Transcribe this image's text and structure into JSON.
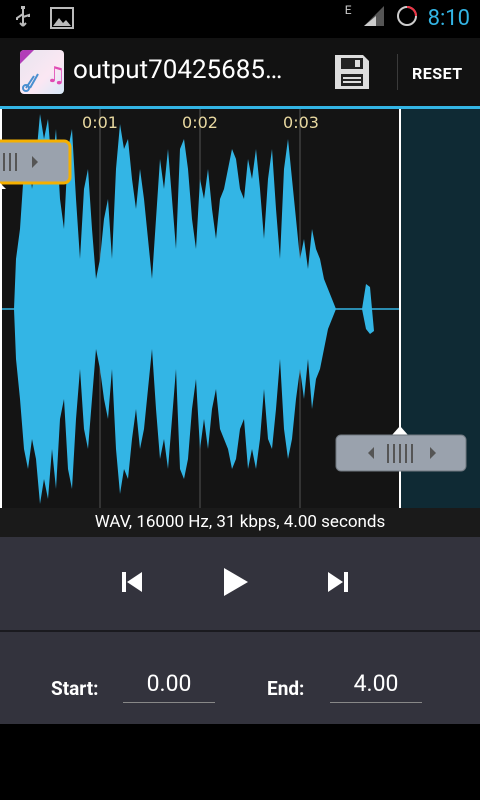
{
  "status_bar": {
    "time": "8:10",
    "network": "E"
  },
  "action_bar": {
    "title": "output70425685…",
    "reset_label": "RESET"
  },
  "waveform": {
    "time_ticks": [
      "0:01",
      "0:02",
      "0:03"
    ]
  },
  "info": {
    "text": "WAV, 16000 Hz, 31 kbps, 4.00 seconds"
  },
  "fields": {
    "start_label": "Start:",
    "start_value": "0.00",
    "end_label": "End:",
    "end_value": "4.00"
  },
  "colors": {
    "accent": "#33b5e5",
    "wave_fill": "#33b5e5",
    "control_bg": "#33333d",
    "handle_highlight": "#f5b000"
  }
}
